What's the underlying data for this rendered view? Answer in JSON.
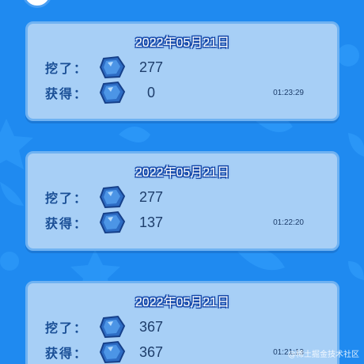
{
  "records": [
    {
      "date": "2022年05月21日",
      "mined_label": "挖了：",
      "mined_value": "277",
      "gained_label": "获得：",
      "gained_value": "0",
      "time": "01:23:29"
    },
    {
      "date": "2022年05月21日",
      "mined_label": "挖了：",
      "mined_value": "277",
      "gained_label": "获得：",
      "gained_value": "137",
      "time": "01:22:20"
    },
    {
      "date": "2022年05月21日",
      "mined_label": "挖了：",
      "mined_value": "367",
      "gained_label": "获得：",
      "gained_value": "367",
      "time": "01:21:13"
    }
  ],
  "icons": {
    "ore": "blue-ore-gem-icon"
  },
  "colors": {
    "background": "#1f8af0",
    "card": "#a7cff6",
    "label": "#1a4f96"
  },
  "watermark": "@稀土掘金技术社区"
}
